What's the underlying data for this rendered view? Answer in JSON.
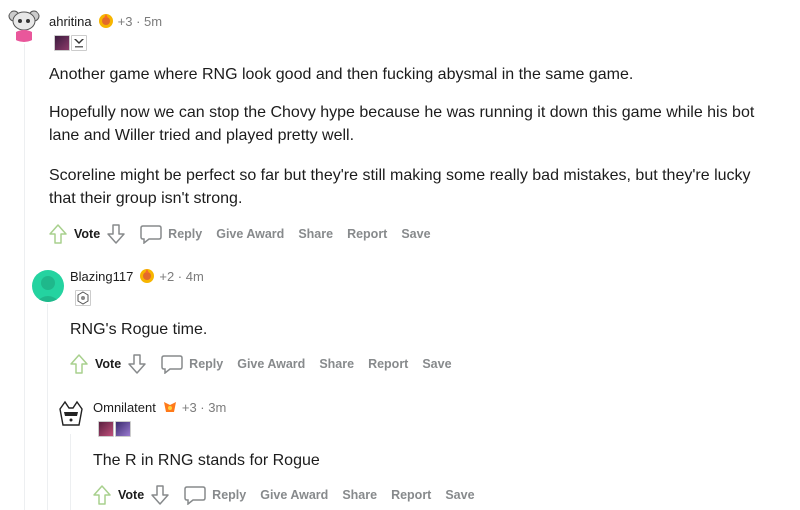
{
  "comments": [
    {
      "username": "ahritina",
      "extra": "+3 · 5m",
      "icons": [
        "award-icon",
        "user-flair-icon"
      ],
      "paragraphs": [
        "Another game where RNG look good and then fucking abysmal in the same game.",
        "Hopefully now we can stop the Chovy hype because he was running it down this game while his bot lane and Willer tried and played pretty well.",
        "Scoreline might be perfect so far but they're still making some really bad mistakes, but they're lucky that their group isn't strong."
      ],
      "actions": {
        "vote": "Vote",
        "reply": "Reply",
        "give_award": "Give Award",
        "share": "Share",
        "report": "Report",
        "save": "Save"
      }
    },
    {
      "username": "Blazing117",
      "extra": "+2 · 4m",
      "paragraphs": [
        "RNG's Rogue time."
      ],
      "actions": {
        "vote": "Vote",
        "reply": "Reply",
        "give_award": "Give Award",
        "share": "Share",
        "report": "Report",
        "save": "Save"
      }
    },
    {
      "username": "Omnilatent",
      "extra": "+3 · 3m",
      "paragraphs": [
        "The R in RNG stands for Rogue"
      ],
      "actions": {
        "vote": "Vote",
        "reply": "Reply",
        "give_award": "Give Award",
        "share": "Share",
        "report": "Report",
        "save": "Save"
      }
    }
  ]
}
